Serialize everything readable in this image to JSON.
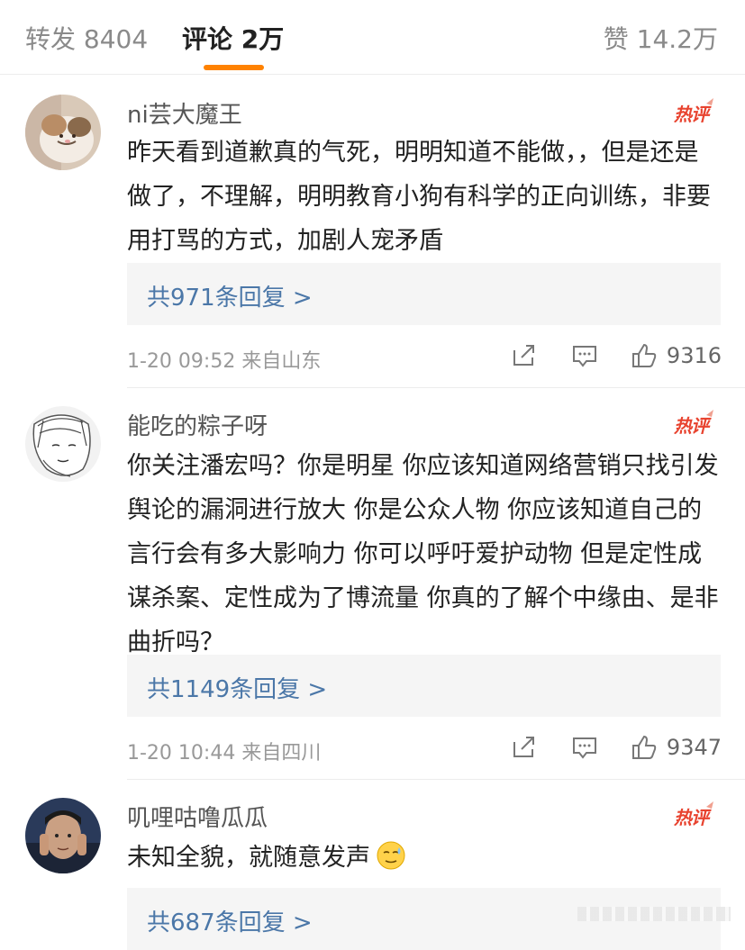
{
  "tabs": {
    "repost": "转发 8404",
    "comments": "评论 2万",
    "likes": "赞 14.2万"
  },
  "hot_label": "热评",
  "comments": [
    {
      "username": "ni芸大魔王",
      "content": "昨天看到道歉真的气死，明明知道不能做，，但是还是做了，不理解，明明教育小狗有科学的正向训练，非要用打骂的方式，加剧人宠矛盾",
      "replies": "共971条回复 >",
      "time": "1-20 09:52  来自山东",
      "likes": "9316"
    },
    {
      "username": "能吃的粽子呀",
      "content": "你关注潘宏吗？你是明星 你应该知道网络营销只找引发舆论的漏洞进行放大 你是公众人物 你应该知道自己的言行会有多大影响力 你可以呼吁爱护动物 但是定性成谋杀案、定性成为了博流量 你真的了解个中缘由、是非曲折吗？",
      "replies": "共1149条回复 >",
      "time": "1-20 10:44  来自四川",
      "likes": "9347"
    },
    {
      "username": "叽哩咕噜瓜瓜",
      "content": "未知全貌，就随意发声",
      "emoji": "sweat-smile-emoji",
      "replies": "共687条回复 >"
    }
  ],
  "colors": {
    "accent": "#ff8200",
    "link": "#4b77a8",
    "hot": "#e8432f"
  },
  "icons": [
    "share-icon",
    "comment-icon",
    "like-icon"
  ]
}
